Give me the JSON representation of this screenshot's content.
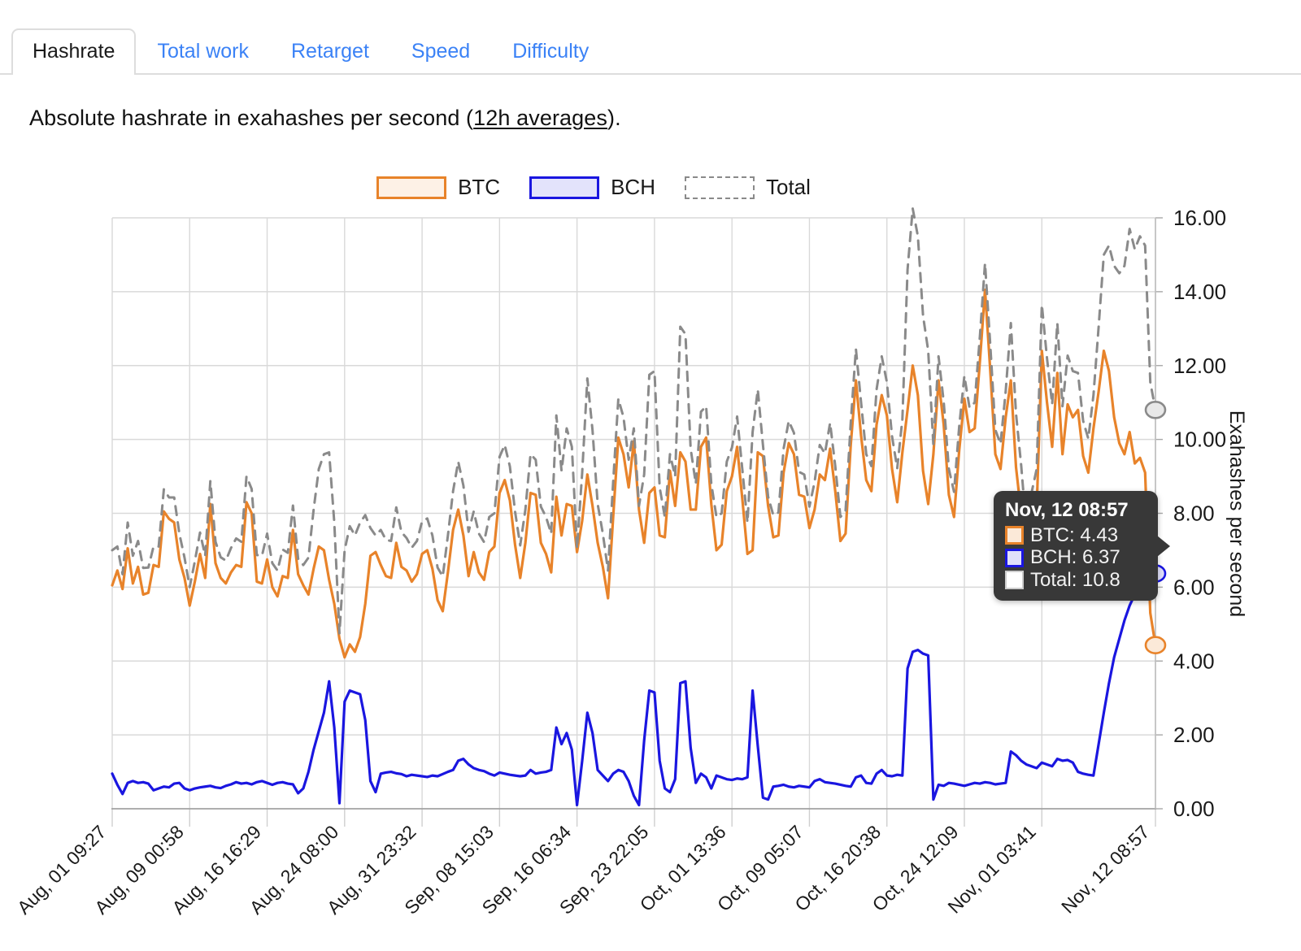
{
  "tabs": [
    {
      "label": "Hashrate",
      "active": true
    },
    {
      "label": "Total work",
      "active": false
    },
    {
      "label": "Retarget",
      "active": false
    },
    {
      "label": "Speed",
      "active": false
    },
    {
      "label": "Difficulty",
      "active": false
    }
  ],
  "caption": {
    "before": "Absolute hashrate in exahashes per second (",
    "link": "12h averages",
    "after": ")."
  },
  "legend": [
    {
      "label": "BTC",
      "color": "#e8832a",
      "fill": "#fdf1e6",
      "style": "solid"
    },
    {
      "label": "BCH",
      "color": "#1a16e0",
      "fill": "#e3e3fb",
      "style": "solid"
    },
    {
      "label": "Total",
      "color": "#8a8a8a",
      "fill": "#ffffff",
      "style": "dashed"
    }
  ],
  "tooltip": {
    "title": "Nov, 12 08:57",
    "rows": [
      {
        "label": "BTC: 4.43",
        "color": "#e8832a"
      },
      {
        "label": "BCH: 6.37",
        "color": "#1a16e0"
      },
      {
        "label": "Total: 10.8",
        "color": "#ffffff"
      }
    ]
  },
  "chart_data": {
    "type": "line",
    "title": "Absolute hashrate in exahashes per second (12h averages).",
    "xlabel": "",
    "ylabel": "Exahashes per second",
    "ylim": [
      0,
      16
    ],
    "yticks": [
      "0.00",
      "2.00",
      "4.00",
      "6.00",
      "8.00",
      "10.00",
      "12.00",
      "14.00",
      "16.00"
    ],
    "ytick_values": [
      0,
      2,
      4,
      6,
      8,
      10,
      12,
      14,
      16
    ],
    "grid": true,
    "legend_position": "top-center",
    "xticks": [
      "Aug, 01 09:27",
      "Aug, 09 00:58",
      "Aug, 16 16:29",
      "Aug, 24 08:00",
      "Aug, 31 23:32",
      "Sep, 08 15:03",
      "Sep, 16 06:34",
      "Sep, 23 22:05",
      "Oct, 01 13:36",
      "Oct, 09 05:07",
      "Oct, 16 20:38",
      "Oct, 24 12:09",
      "Nov, 01 03:41",
      "Nov, 12 08:57"
    ],
    "xtick_positions": [
      0,
      15,
      30,
      45,
      60,
      75,
      90,
      105,
      120,
      135,
      150,
      165,
      180,
      202
    ],
    "n_points": 203,
    "series": [
      {
        "name": "BTC",
        "color": "#e8832a",
        "style": "solid",
        "end_marker": true,
        "end_value": 4.43,
        "values": [
          6.05,
          6.45,
          5.95,
          7.05,
          6.1,
          6.55,
          5.8,
          5.85,
          6.6,
          6.55,
          8.05,
          7.85,
          7.75,
          6.75,
          6.25,
          5.5,
          6.15,
          6.9,
          6.25,
          8.25,
          6.65,
          6.25,
          6.1,
          6.4,
          6.6,
          6.55,
          8.3,
          8.0,
          6.15,
          6.1,
          6.75,
          6.0,
          5.75,
          6.3,
          6.25,
          7.55,
          6.35,
          6.05,
          5.8,
          6.5,
          7.1,
          7.0,
          6.2,
          5.55,
          4.6,
          4.1,
          4.45,
          4.25,
          4.65,
          5.55,
          6.85,
          6.95,
          6.6,
          6.3,
          6.25,
          7.2,
          6.55,
          6.45,
          6.15,
          6.35,
          6.9,
          7.0,
          6.5,
          5.65,
          5.35,
          6.4,
          7.55,
          8.1,
          7.4,
          6.3,
          6.95,
          6.4,
          6.2,
          6.95,
          7.1,
          8.55,
          8.9,
          8.35,
          7.15,
          6.25,
          7.2,
          8.55,
          8.5,
          7.2,
          6.9,
          6.4,
          8.45,
          7.4,
          8.25,
          8.2,
          6.95,
          7.8,
          9.05,
          8.2,
          7.2,
          6.55,
          5.7,
          7.9,
          10.05,
          9.6,
          8.7,
          9.95,
          8.1,
          7.2,
          8.55,
          8.7,
          7.4,
          7.35,
          9.15,
          8.2,
          9.65,
          9.4,
          8.1,
          8.1,
          9.8,
          10.05,
          8.25,
          7.0,
          7.15,
          8.6,
          9.0,
          9.8,
          8.4,
          6.9,
          7.0,
          9.65,
          9.55,
          8.2,
          7.35,
          7.4,
          9.1,
          9.9,
          9.6,
          8.5,
          8.45,
          7.6,
          8.1,
          9.05,
          8.9,
          9.75,
          8.6,
          7.25,
          7.45,
          9.85,
          11.6,
          10.1,
          8.9,
          8.6,
          10.4,
          11.2,
          10.65,
          9.2,
          8.3,
          9.65,
          10.8,
          12.0,
          11.2,
          9.15,
          8.25,
          9.6,
          11.6,
          10.4,
          8.5,
          7.9,
          9.7,
          11.1,
          10.2,
          10.3,
          12.1,
          14.05,
          11.9,
          9.6,
          9.2,
          10.6,
          11.6,
          9.25,
          8.0,
          6.4,
          7.4,
          8.1,
          12.4,
          11.0,
          9.8,
          11.8,
          9.6,
          10.95,
          10.6,
          10.8,
          9.55,
          9.1,
          10.3,
          11.3,
          12.4,
          11.85,
          10.6,
          9.9,
          9.6,
          10.2,
          9.35,
          9.5,
          9.1,
          5.3,
          4.43
        ]
      },
      {
        "name": "BCH",
        "color": "#1a16e0",
        "style": "solid",
        "end_marker": true,
        "end_value": 6.37,
        "values": [
          0.95,
          0.65,
          0.4,
          0.7,
          0.75,
          0.7,
          0.72,
          0.68,
          0.5,
          0.55,
          0.6,
          0.58,
          0.68,
          0.7,
          0.55,
          0.5,
          0.55,
          0.58,
          0.6,
          0.62,
          0.58,
          0.56,
          0.62,
          0.66,
          0.72,
          0.68,
          0.7,
          0.66,
          0.72,
          0.75,
          0.7,
          0.65,
          0.7,
          0.72,
          0.68,
          0.66,
          0.42,
          0.55,
          1.0,
          1.6,
          2.1,
          2.6,
          3.45,
          2.2,
          0.15,
          2.9,
          3.2,
          3.15,
          3.1,
          2.4,
          0.75,
          0.45,
          0.95,
          0.98,
          1.0,
          0.96,
          0.94,
          0.88,
          0.92,
          0.9,
          0.88,
          0.86,
          0.9,
          0.88,
          0.94,
          1.0,
          1.05,
          1.3,
          1.35,
          1.2,
          1.1,
          1.05,
          1.02,
          0.95,
          0.9,
          0.98,
          0.95,
          0.92,
          0.9,
          0.88,
          0.9,
          1.05,
          0.95,
          0.98,
          1.0,
          1.05,
          2.2,
          1.75,
          2.05,
          1.6,
          0.1,
          1.3,
          2.6,
          2.05,
          1.05,
          0.9,
          0.75,
          0.95,
          1.05,
          1.0,
          0.75,
          0.35,
          0.1,
          1.85,
          3.2,
          3.15,
          1.3,
          0.55,
          0.45,
          0.8,
          3.4,
          3.45,
          1.65,
          0.7,
          0.95,
          0.85,
          0.55,
          0.9,
          0.85,
          0.8,
          0.78,
          0.82,
          0.8,
          0.85,
          3.2,
          1.7,
          0.3,
          0.25,
          0.6,
          0.62,
          0.65,
          0.6,
          0.58,
          0.62,
          0.6,
          0.58,
          0.75,
          0.8,
          0.72,
          0.7,
          0.68,
          0.65,
          0.62,
          0.6,
          0.85,
          0.9,
          0.7,
          0.68,
          0.95,
          1.05,
          0.9,
          0.88,
          0.92,
          0.9,
          3.8,
          4.25,
          4.3,
          4.2,
          4.15,
          0.25,
          0.65,
          0.62,
          0.7,
          0.68,
          0.65,
          0.62,
          0.66,
          0.7,
          0.68,
          0.72,
          0.7,
          0.66,
          0.68,
          0.7,
          1.55,
          1.45,
          1.3,
          1.2,
          1.15,
          1.1,
          1.25,
          1.2,
          1.15,
          1.35,
          1.3,
          1.32,
          1.25,
          1.0,
          0.95,
          0.92,
          0.9,
          1.75,
          2.6,
          3.4,
          4.1,
          4.6,
          5.1,
          5.5,
          5.8,
          6.0,
          6.15,
          6.25,
          6.37
        ]
      },
      {
        "name": "Total",
        "color": "#8a8a8a",
        "style": "dashed",
        "end_marker": true,
        "end_value": 10.8,
        "values": [
          7.0,
          7.1,
          6.35,
          7.75,
          6.85,
          7.25,
          6.52,
          6.53,
          7.1,
          7.1,
          8.65,
          8.43,
          8.43,
          7.45,
          6.8,
          6.0,
          6.7,
          7.48,
          6.85,
          8.87,
          7.23,
          6.81,
          6.72,
          7.06,
          7.32,
          7.23,
          9.0,
          8.66,
          6.87,
          6.85,
          7.45,
          6.65,
          6.45,
          7.02,
          6.93,
          8.21,
          6.77,
          6.6,
          6.8,
          8.1,
          9.2,
          9.6,
          9.65,
          7.75,
          4.75,
          7.0,
          7.65,
          7.4,
          7.75,
          7.95,
          7.6,
          7.4,
          7.55,
          7.28,
          7.25,
          8.16,
          7.49,
          7.33,
          7.07,
          7.25,
          7.78,
          7.86,
          7.4,
          6.53,
          6.29,
          7.4,
          8.6,
          9.4,
          8.75,
          7.5,
          8.05,
          7.45,
          7.22,
          7.9,
          8.0,
          9.53,
          9.85,
          9.27,
          8.05,
          7.13,
          8.1,
          9.6,
          9.45,
          8.18,
          7.9,
          7.45,
          10.65,
          9.15,
          10.3,
          9.8,
          7.05,
          9.1,
          11.65,
          10.25,
          8.25,
          7.45,
          6.45,
          8.85,
          11.1,
          10.6,
          9.45,
          10.3,
          8.2,
          9.05,
          11.75,
          11.85,
          8.7,
          7.9,
          9.6,
          9.0,
          13.05,
          12.85,
          9.75,
          8.8,
          10.75,
          10.9,
          8.8,
          7.9,
          8.0,
          9.4,
          9.78,
          10.62,
          9.2,
          7.75,
          10.2,
          11.35,
          9.85,
          8.45,
          7.95,
          8.02,
          9.75,
          10.5,
          10.18,
          9.12,
          9.05,
          8.18,
          8.85,
          9.85,
          9.62,
          10.45,
          9.28,
          7.9,
          8.07,
          10.45,
          12.45,
          11.0,
          9.6,
          9.28,
          11.35,
          12.25,
          11.55,
          10.08,
          9.22,
          10.55,
          14.6,
          16.25,
          15.5,
          13.35,
          12.4,
          9.85,
          12.25,
          11.02,
          9.2,
          8.58,
          10.35,
          11.72,
          10.86,
          11.0,
          12.78,
          14.77,
          12.6,
          10.26,
          9.88,
          11.3,
          13.15,
          10.7,
          9.3,
          7.6,
          8.55,
          9.2,
          13.65,
          12.2,
          10.95,
          13.15,
          10.9,
          12.27,
          11.85,
          11.8,
          10.5,
          10.02,
          11.2,
          13.05,
          15.0,
          15.25,
          14.7,
          14.5,
          14.7,
          15.7,
          15.15,
          15.5,
          15.25,
          11.55,
          10.8
        ]
      }
    ]
  }
}
